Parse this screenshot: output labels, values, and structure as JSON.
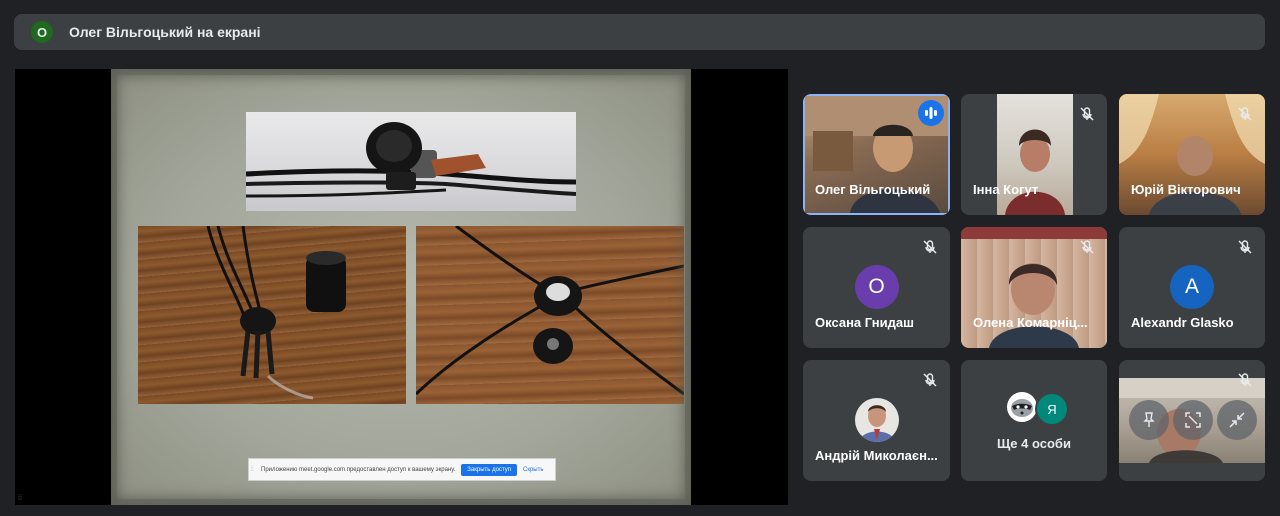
{
  "banner": {
    "avatar_letter": "О",
    "title": "Олег Вільгоцький на екрані"
  },
  "presentation": {
    "notification": {
      "message": "Приложению meet.google.com предоставлен доступ к вашему экрану.",
      "stop_button": "Закрыть доступ",
      "hide_link": "Скрыть"
    }
  },
  "participants": [
    {
      "name": "Олег Вільгоцький",
      "speaking": true,
      "muted": false
    },
    {
      "name": "Інна Когут",
      "muted": true
    },
    {
      "name": "Юрій Вікторович",
      "muted": true
    },
    {
      "name": "Оксана Гнидаш",
      "initial": "О",
      "avatar_color": "#6a3dad",
      "muted": true
    },
    {
      "name": "Олена Комарніц...",
      "muted": true
    },
    {
      "name": "Alexandr Glasko",
      "initial": "A",
      "avatar_color": "#1565c0",
      "muted": true
    },
    {
      "name": "Андрій Миколаєн...",
      "muted": true
    },
    {
      "more_label": "Ще 4 особи",
      "avatar_letter": "Я",
      "avatar_color": "#00897b"
    },
    {
      "muted": true
    }
  ],
  "colors": {
    "background": "#202124",
    "tile": "#3c4043",
    "accent": "#1a73e8",
    "active_border": "#8ab4f8"
  },
  "icons": [
    "mic-off-icon",
    "speaking-indicator-icon",
    "pin-icon",
    "fullscreen-icon",
    "minimize-icon"
  ]
}
